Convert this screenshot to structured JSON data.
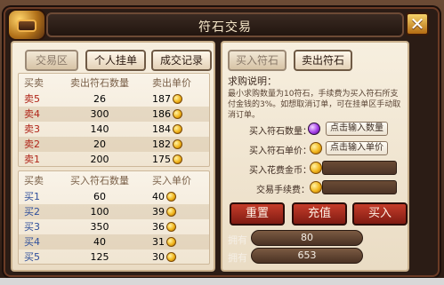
{
  "window": {
    "title": "符石交易"
  },
  "tabs": [
    {
      "label": "交易区"
    },
    {
      "label": "个人挂单"
    },
    {
      "label": "成交记录"
    }
  ],
  "right_tabs": [
    {
      "label": "买入符石"
    },
    {
      "label": "卖出符石"
    }
  ],
  "sell_table": {
    "headers": [
      "买卖",
      "卖出符石数量",
      "卖出单价"
    ],
    "rows": [
      {
        "side": "卖5",
        "qty": "26",
        "price": "187"
      },
      {
        "side": "卖4",
        "qty": "300",
        "price": "186"
      },
      {
        "side": "卖3",
        "qty": "140",
        "price": "184"
      },
      {
        "side": "卖2",
        "qty": "20",
        "price": "182"
      },
      {
        "side": "卖1",
        "qty": "200",
        "price": "175"
      }
    ]
  },
  "buy_table": {
    "headers": [
      "买卖",
      "买入符石数量",
      "买入单价"
    ],
    "rows": [
      {
        "side": "买1",
        "qty": "60",
        "price": "40"
      },
      {
        "side": "买2",
        "qty": "100",
        "price": "39"
      },
      {
        "side": "买3",
        "qty": "350",
        "price": "36"
      },
      {
        "side": "买4",
        "qty": "40",
        "price": "31"
      },
      {
        "side": "买5",
        "qty": "125",
        "price": "30"
      }
    ]
  },
  "purchase_info": {
    "title": "求购说明：",
    "text": "最小求购数量为10符石，手续费为买入符石所支付金钱的3%。如想取消订单，可在挂单区手动取消订单。"
  },
  "form": {
    "buy_qty_label": "买入符石数量：",
    "buy_qty_button": "点击输入数量",
    "buy_price_label": "买入符石单价：",
    "buy_price_button": "点击输入单价",
    "cost_label": "买入花费金币：",
    "fee_label": "交易手续费："
  },
  "actions": {
    "reset": "重置",
    "recharge": "充值",
    "buy": "买入"
  },
  "holdings": [
    {
      "label": "拥有",
      "icon": "purple-gem-icon",
      "value": "80"
    },
    {
      "label": "拥有",
      "icon": "gold-coin-icon",
      "value": "653"
    }
  ],
  "colors": {
    "sell_text": "#b02418",
    "buy_text": "#2f4f9b",
    "accent_red": "#c53c2a",
    "title_text": "#f6e7c9"
  }
}
